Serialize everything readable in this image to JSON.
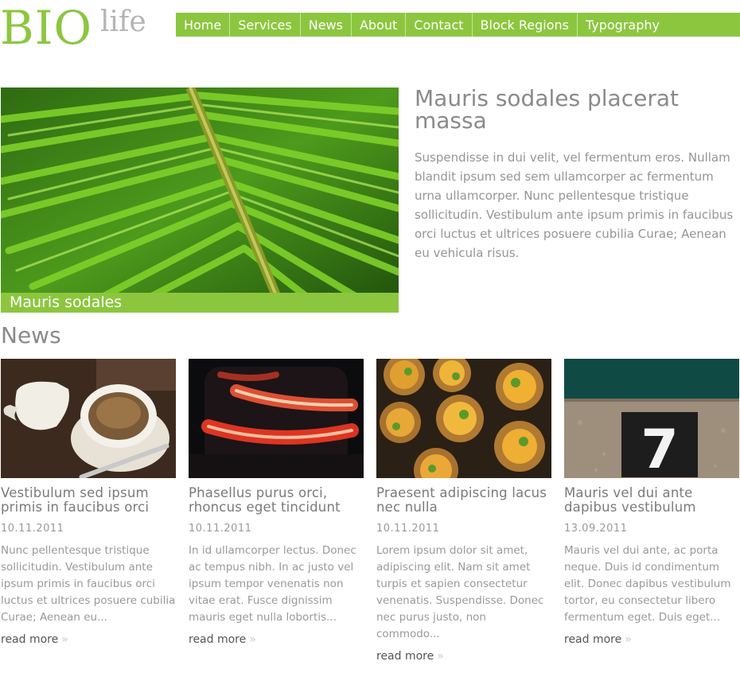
{
  "logo": {
    "main": "BIO",
    "sub": "life"
  },
  "nav": {
    "items": [
      "Home",
      "Services",
      "News",
      "About",
      "Contact",
      "Block Regions",
      "Typography"
    ]
  },
  "hero": {
    "caption": "Mauris sodales",
    "image_icon": "palm-leaf-image"
  },
  "feature": {
    "title": "Mauris sodales placerat massa",
    "body": "Suspendisse in dui velit, vel fermentum eros. Nullam blandit ipsum sed sem ullamcorper ac fermentum urna ullamcorper. Nunc pellentesque tristique sollicitudin. Vestibulum ante ipsum primis in faucibus orci luctus et ultrices posuere cubilia Curae; Aenean eu vehicula risus."
  },
  "news": {
    "heading": "News",
    "readmore_label": "read more",
    "readmore_icon": "»",
    "items": [
      {
        "title": "Vestibulum sed ipsum primis in faucibus orci",
        "date": "10.11.2011",
        "excerpt": "Nunc pellentesque tristique sollicitudin. Vestibulum ante ipsum primis in faucibus orci luctus et ultrices posuere cubilia Curae; Aenean eu...",
        "image_icon": "coffee-image"
      },
      {
        "title": "Phasellus purus orci, rhoncus eget tincidunt",
        "date": "10.11.2011",
        "excerpt": "In id ullamcorper lectus. Donec ac tempus nibh. In ac justo vel ipsum tempor venenatis non vitae erat. Fusce dignissim mauris eget nulla lobortis...",
        "image_icon": "red-light-image"
      },
      {
        "title": "Praesent adipiscing lacus nec nulla",
        "date": "10.11.2011",
        "excerpt": "Lorem ipsum dolor sit amet, adipiscing elit. Nam sit amet turpis et sapien consectetur venenatis. Suspendisse. Donec nec purus justo, non commodo...",
        "image_icon": "tarts-image"
      },
      {
        "title": "Mauris vel dui ante dapibus vestibulum",
        "date": "13.09.2011",
        "excerpt": "Mauris vel dui ante, ac porta neque. Duis id condimentum elit. Donec dapibus vestibulum tortor, eu consectetur libero fermentum eget. Duis eget...",
        "image_icon": "number-seven-image",
        "image_text": "7"
      }
    ]
  },
  "colors": {
    "accent": "#8cc63f",
    "text": "#888888"
  }
}
